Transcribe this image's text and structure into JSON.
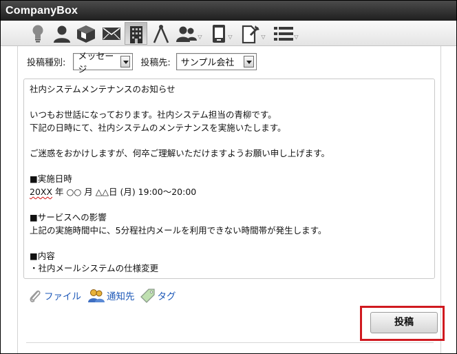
{
  "window": {
    "title": "CompanyBox"
  },
  "toolbar": {
    "items": [
      {
        "icon": "lightbulb-icon"
      },
      {
        "icon": "user-icon"
      },
      {
        "icon": "box-icon"
      },
      {
        "icon": "mail-icon"
      },
      {
        "icon": "building-icon",
        "active": true
      },
      {
        "icon": "compass-icon"
      },
      {
        "icon": "users-icon",
        "dropdown": true
      },
      {
        "icon": "phone-icon",
        "dropdown": true
      },
      {
        "icon": "document-pin-icon",
        "dropdown": true
      },
      {
        "icon": "list-icon",
        "dropdown": true
      }
    ]
  },
  "form": {
    "type_label": "投稿種別:",
    "type_value": "メッセージ",
    "dest_label": "投稿先:",
    "dest_value": "サンプル会社"
  },
  "message": {
    "lines": [
      "社内システムメンテナンスのお知らせ",
      "",
      "いつもお世話になっております。社内システム担当の青柳です。",
      "下記の日時にて、社内システムのメンテナンスを実施いたします。",
      "",
      "ご迷惑をおかけしますが、何卒ご理解いただけますようお願い申し上げます。",
      "",
      "■実施日時",
      "20XX 年 ○○ 月 △△日 (月) 19:00〜20:00",
      "",
      "■サービスへの影響",
      "上記の実施時間中に、5分程社内メールを利用できない時間帯が発生します。",
      "",
      "■内容",
      "・社内メールシステムの仕様変更"
    ],
    "datetime_prefix": "20XX",
    "datetime_rest": " 年 ○○ 月 △△日 (月) 19:00〜20:00"
  },
  "actions": {
    "file_label": "ファイル",
    "notify_label": "通知先",
    "tag_label": "タグ"
  },
  "submit": {
    "label": "投稿"
  },
  "colors": {
    "highlight": "#d0191f",
    "link": "#1d58b8",
    "titlebar": "#2b2b2b"
  }
}
